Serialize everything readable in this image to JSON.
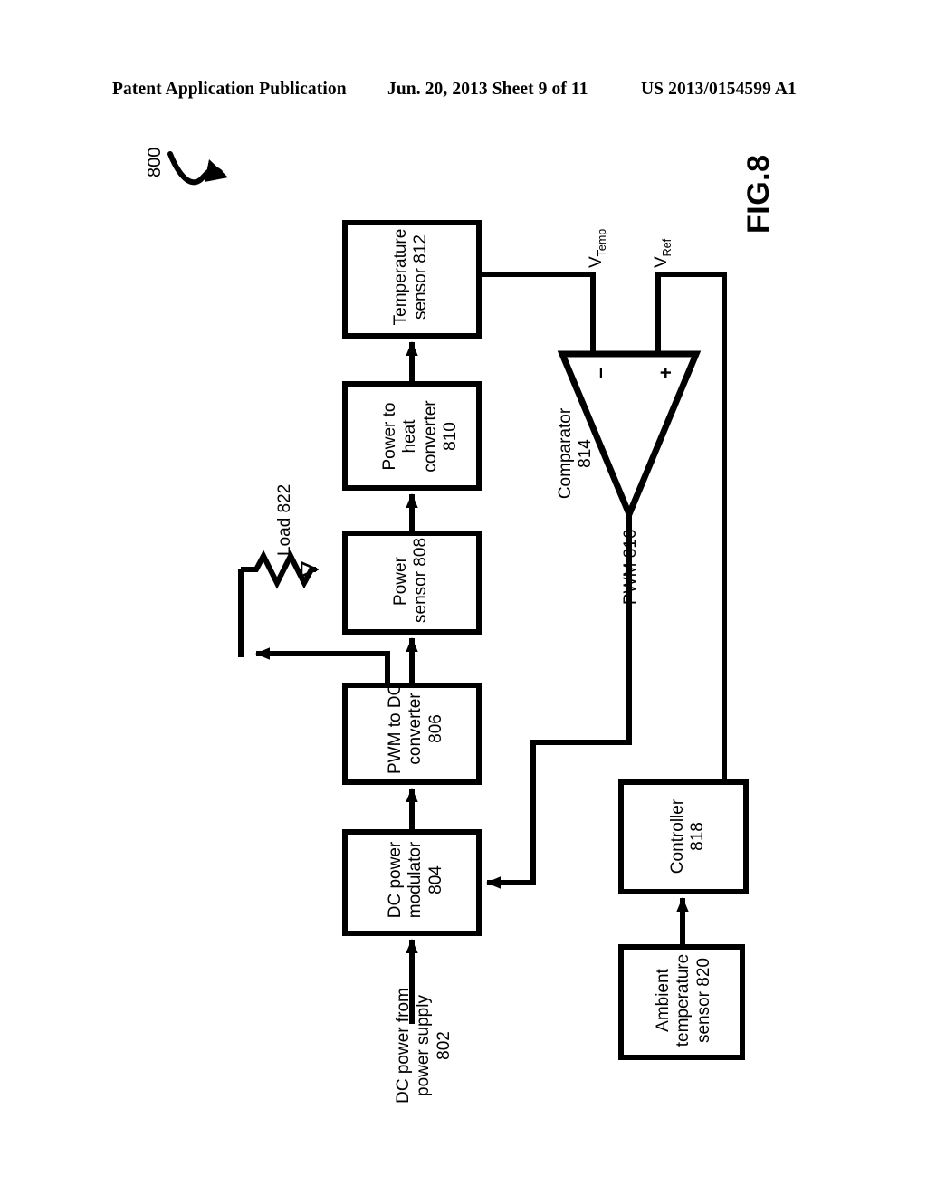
{
  "header": {
    "left": "Patent Application Publication",
    "middle": "Jun. 20, 2013  Sheet 9 of 11",
    "right": "US 2013/0154599 A1"
  },
  "figure": {
    "title": "FIG.8",
    "system_ref": "800"
  },
  "blocks": [
    {
      "id": "temperature-sensor",
      "ref": "812",
      "lines": [
        "Temperature",
        "sensor 812"
      ]
    },
    {
      "id": "power-to-heat-converter",
      "ref": "810",
      "lines": [
        "Power to",
        "heat",
        "converter",
        "810"
      ]
    },
    {
      "id": "power-sensor",
      "ref": "808",
      "lines": [
        "Power",
        "sensor 808"
      ]
    },
    {
      "id": "pwm-to-dc-converter",
      "ref": "806",
      "lines": [
        "PWM to DC",
        "converter",
        "806"
      ]
    },
    {
      "id": "dc-power-modulator",
      "ref": "804",
      "lines": [
        "DC power",
        "modulator",
        "804"
      ]
    },
    {
      "id": "controller",
      "ref": "818",
      "lines": [
        "Controller",
        "818"
      ]
    },
    {
      "id": "ambient-temperature-sensor",
      "ref": "820",
      "lines": [
        "Ambient",
        "temperature",
        "sensor 820"
      ]
    }
  ],
  "comparator": {
    "id": "comparator",
    "ref": "814",
    "lines": [
      "Comparator",
      "814"
    ],
    "minus_label": "–",
    "plus_label": "+"
  },
  "signals": {
    "v_temp": {
      "base": "V",
      "sub": "Temp"
    },
    "v_ref": {
      "base": "V",
      "sub": "Ref"
    },
    "pwm": "PWM 816",
    "dc_input": [
      "DC power from",
      "power supply",
      "802"
    ],
    "load": "Load 822"
  },
  "colors": {
    "ink": "#000000",
    "paper": "#ffffff"
  }
}
